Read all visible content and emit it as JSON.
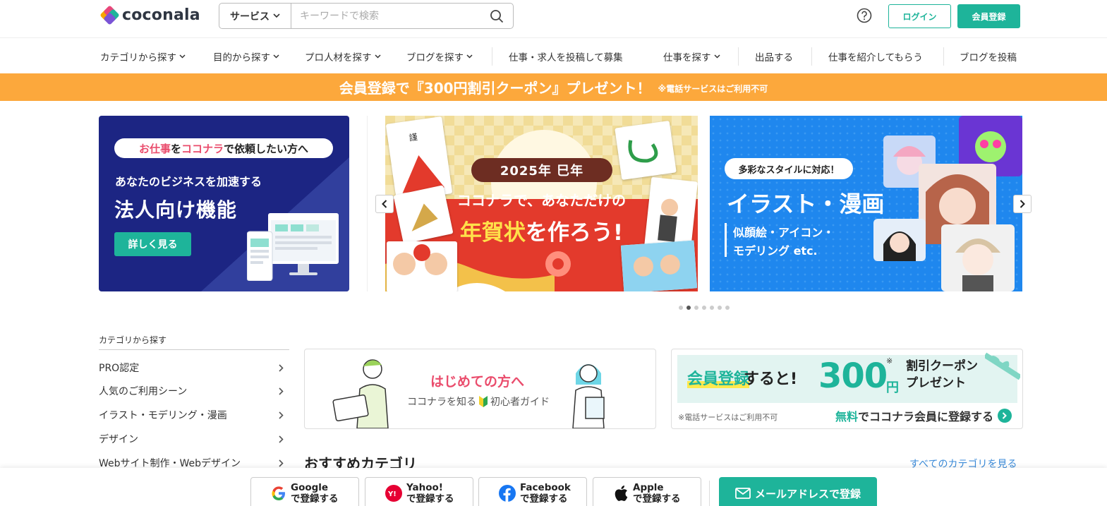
{
  "header": {
    "logo_text": "coconala",
    "search_category": "サービス",
    "search_placeholder": "キーワードで検索",
    "login_label": "ログイン",
    "register_label": "会員登録"
  },
  "nav": {
    "items": [
      "カテゴリから探す",
      "目的から探す",
      "プロ人材を探す",
      "ブログを探す",
      "仕事・求人を投稿して募集",
      "仕事を探す",
      "出品する",
      "仕事を紹介してもらう",
      "ブログを投稿"
    ]
  },
  "promo": {
    "main": "会員登録で『300円割引クーポン』プレゼント！",
    "note": "※電話サービスはご利用不可"
  },
  "banners": {
    "corp": {
      "pill_a": "お仕事",
      "pill_b": "を",
      "pill_c": "ココナラ",
      "pill_d": "で依頼したい方へ",
      "sub": "あなたのビジネスを加速する",
      "title": "法人向け機能",
      "button": "詳しく見る"
    },
    "nenga": {
      "year": "2025年 巳年",
      "line1": "ココナラで、あなただけの",
      "line2_a": "年賀状",
      "line2_b": "を作ろう!"
    },
    "illust": {
      "pill": "多彩なスタイルに対応！",
      "title": "イラスト・漫画",
      "sub1": "似顔絵・アイコン・",
      "sub2": "モデリング etc."
    }
  },
  "carousel": {
    "dot_count": 7,
    "active_index": 1
  },
  "sidebar": {
    "title": "カテゴリから探す",
    "items": [
      "PRO認定",
      "人気のご利用シーン",
      "イラスト・モデリング・漫画",
      "デザイン",
      "Webサイト制作・Webデザイン"
    ]
  },
  "guide": {
    "title": "はじめての方へ",
    "sub_a": "ココナラを知る",
    "sub_b": "初心者ガイド"
  },
  "coupon": {
    "a": "会員登録",
    "b": "すると!",
    "amount": "300",
    "yen": "円",
    "asterisk": "※",
    "c1": "割引クーポン",
    "c2": "プレゼント",
    "note": "※電話サービスはご利用不可",
    "link_a": "無料",
    "link_b": "でココナラ会員に登録する"
  },
  "recommend": {
    "title": "おすすめカテゴリ",
    "see_all": "すべてのカテゴリを見る"
  },
  "signup_bar": {
    "google": [
      "Google",
      "で登録する"
    ],
    "yahoo": [
      "Yahoo!",
      "で登録する"
    ],
    "facebook": [
      "Facebook",
      "で登録する"
    ],
    "apple": [
      "Apple",
      "で登録する"
    ],
    "mail": "メールアドレスで登録"
  },
  "colors": {
    "brand_green": "#1eb49a",
    "promo_orange": "#fca83c",
    "accent_pink": "#ea4c6c",
    "link_blue": "#3a8ad8"
  }
}
